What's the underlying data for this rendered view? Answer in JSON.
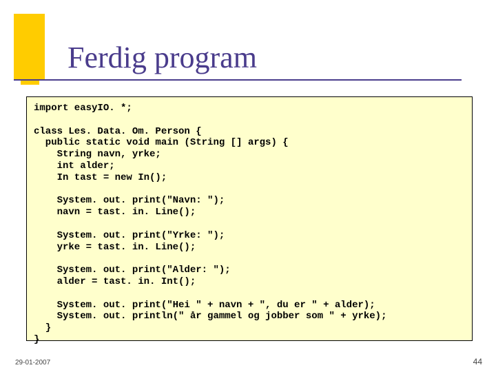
{
  "title": "Ferdig program",
  "code": "import easyIO. *;\n\nclass Les. Data. Om. Person {\n  public static void main (String [] args) {\n    String navn, yrke;\n    int alder;\n    In tast = new In();\n\n    System. out. print(\"Navn: \");\n    navn = tast. in. Line();\n\n    System. out. print(\"Yrke: \");\n    yrke = tast. in. Line();\n\n    System. out. print(\"Alder: \");\n    alder = tast. in. Int();\n\n    System. out. print(\"Hei \" + navn + \", du er \" + alder);\n    System. out. println(\" år gammel og jobber som \" + yrke);\n  }\n}",
  "footer": {
    "date": "29-01-2007",
    "page": "44"
  }
}
